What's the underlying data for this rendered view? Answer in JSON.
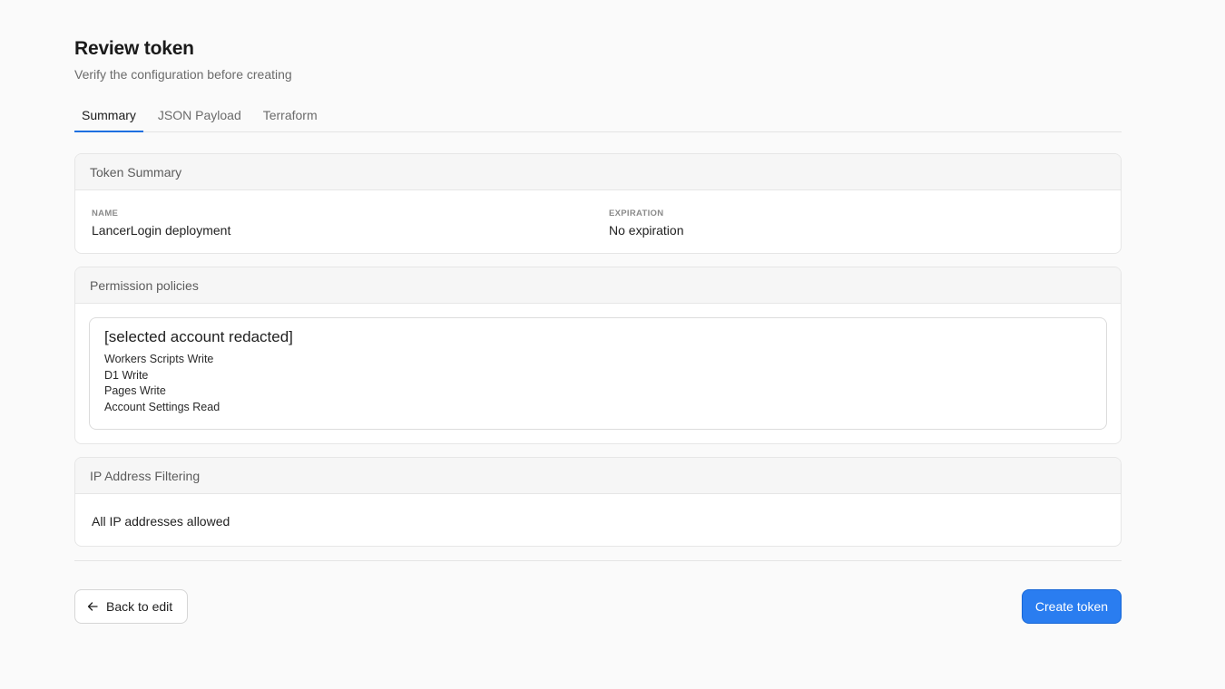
{
  "header": {
    "title": "Review token",
    "subtitle": "Verify the configuration before creating"
  },
  "tabs": [
    {
      "label": "Summary",
      "active": true
    },
    {
      "label": "JSON Payload",
      "active": false
    },
    {
      "label": "Terraform",
      "active": false
    }
  ],
  "summary": {
    "heading": "Token Summary",
    "name_label": "NAME",
    "name_value": "LancerLogin deployment",
    "expiration_label": "EXPIRATION",
    "expiration_value": "No expiration"
  },
  "policies": {
    "heading": "Permission policies",
    "account": "[selected account redacted]",
    "permissions": [
      "Workers Scripts Write",
      "D1 Write",
      "Pages Write",
      "Account Settings Read"
    ]
  },
  "ip_filtering": {
    "heading": "IP Address Filtering",
    "value": "All IP addresses allowed"
  },
  "actions": {
    "back_label": "Back to edit",
    "back_icon": "arrow-left-icon",
    "create_label": "Create token"
  },
  "colors": {
    "accent": "#2a7df0",
    "tab_underline": "#1d6fe0"
  }
}
